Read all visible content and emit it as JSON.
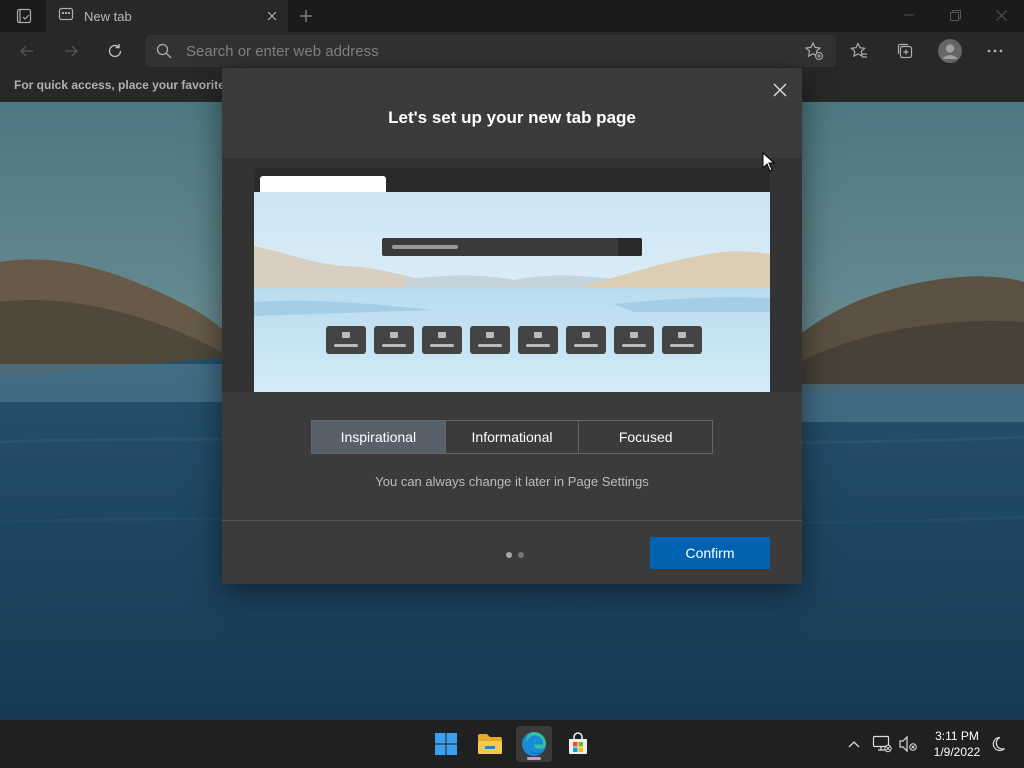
{
  "browser": {
    "tab_title": "New tab",
    "address_placeholder": "Search or enter web address",
    "favorites_hint": "For quick access, place your favorites h"
  },
  "dialog": {
    "title": "Let's set up your new tab page",
    "options": [
      "Inspirational",
      "Informational",
      "Focused"
    ],
    "selected_option": "Inspirational",
    "hint": "You can always change it later in Page Settings",
    "page_indicator": {
      "current": 1,
      "total": 2
    },
    "confirm_label": "Confirm"
  },
  "taskbar": {
    "apps": [
      "start-icon",
      "file-explorer-icon",
      "edge-icon",
      "store-icon"
    ],
    "time": "3:11 PM",
    "date": "1/9/2022"
  },
  "colors": {
    "accent": "#0063b1",
    "dialog_bg": "#3b3b3b",
    "selected_segment": "#58616b"
  }
}
